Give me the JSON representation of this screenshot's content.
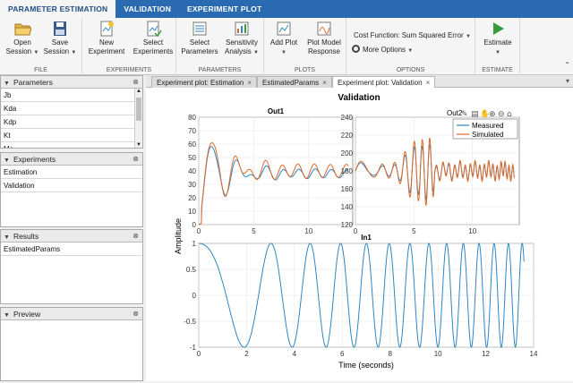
{
  "tabs": [
    {
      "label": "PARAMETER ESTIMATION",
      "active": true
    },
    {
      "label": "VALIDATION",
      "active": false
    },
    {
      "label": "EXPERIMENT PLOT",
      "active": false
    }
  ],
  "ribbon": {
    "file": {
      "label": "FILE",
      "open": "Open",
      "open2": "Session",
      "save": "Save",
      "save2": "Session"
    },
    "experiments": {
      "label": "EXPERIMENTS",
      "new": "New",
      "new2": "Experiment",
      "select": "Select",
      "select2": "Experiments"
    },
    "parameters": {
      "label": "PARAMETERS",
      "select": "Select",
      "select2": "Parameters",
      "sens": "Sensitivity",
      "sens2": "Analysis"
    },
    "plots": {
      "label": "PLOTS",
      "add": "Add Plot",
      "model": "Plot Model",
      "model2": "Response"
    },
    "options": {
      "label": "OPTIONS",
      "cost": "Cost Function: Sum Squared Error",
      "more": "More Options"
    },
    "estimate": {
      "label": "ESTIMATE",
      "btn": "Estimate"
    }
  },
  "panels": {
    "parameters": {
      "title": "Parameters",
      "items": [
        "Jb",
        "Kda",
        "Kdp",
        "Kt",
        "Ma"
      ]
    },
    "experiments": {
      "title": "Experiments",
      "items": [
        "Estimation",
        "Validation"
      ]
    },
    "results": {
      "title": "Results",
      "items": [
        "EstimatedParams"
      ]
    },
    "preview": {
      "title": "Preview"
    }
  },
  "doc_tabs": [
    "Experiment plot: Estimation",
    "EstimatedParams",
    "Experiment plot: Validation"
  ],
  "colors": {
    "blue": "#2e86c1",
    "orange": "#e06a2c",
    "ribbon_blue": "#2a6ab0"
  },
  "chart_data": [
    {
      "type": "line",
      "title": "Out1",
      "xlim": [
        0,
        14
      ],
      "ylim": [
        0,
        80
      ],
      "xticks": [
        0,
        5,
        10
      ],
      "yticks": [
        0,
        10,
        20,
        30,
        40,
        50,
        60,
        70,
        80
      ],
      "series": [
        {
          "name": "Measured",
          "color": "#2e86c1",
          "model": {
            "steady": 38,
            "initial": 0,
            "peak": 78
          }
        },
        {
          "name": "Simulated",
          "color": "#e06a2c",
          "model": {
            "steady": 40,
            "initial": 0,
            "peak": 80
          }
        }
      ]
    },
    {
      "type": "line",
      "title": "Out2",
      "xlim": [
        0,
        14
      ],
      "ylim": [
        120,
        240
      ],
      "xticks": [
        0,
        5,
        10
      ],
      "yticks": [
        120,
        140,
        160,
        180,
        200,
        220,
        240
      ],
      "legend": {
        "position": "top-right",
        "entries": [
          "Measured",
          "Simulated"
        ]
      },
      "series": [
        {
          "name": "Measured",
          "color": "#2e86c1"
        },
        {
          "name": "Simulated",
          "color": "#e06a2c"
        }
      ]
    },
    {
      "type": "line",
      "title": "In1",
      "xlabel": "Time (seconds)",
      "xlim": [
        0,
        14
      ],
      "ylim": [
        -1,
        1
      ],
      "xticks": [
        0,
        2,
        4,
        6,
        8,
        10,
        12,
        14
      ],
      "yticks": [
        -1,
        -0.5,
        0,
        0.5,
        1
      ],
      "series": [
        {
          "name": "In1",
          "color": "#2e86c1",
          "model": {
            "type": "chirp",
            "amplitude": 1
          }
        }
      ]
    }
  ],
  "figure": {
    "title": "Validation",
    "ylabel": "Amplitude"
  }
}
